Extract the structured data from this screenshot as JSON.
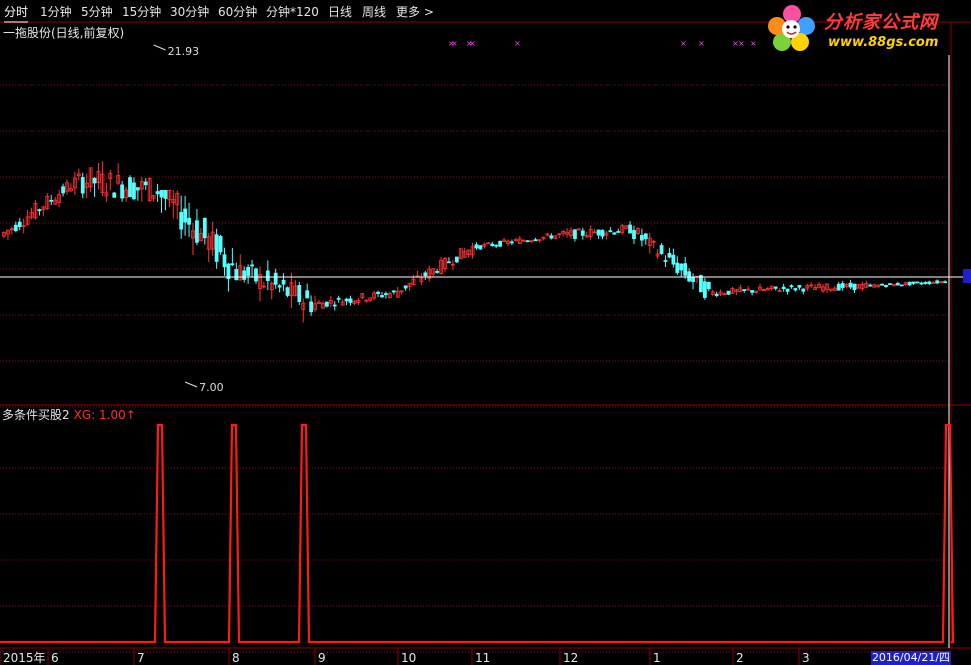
{
  "toolbar": {
    "tabs": [
      "分时",
      "1分钟",
      "5分钟",
      "15分钟",
      "30分钟",
      "60分钟",
      "分钟*120",
      "日线",
      "周线",
      "更多 >"
    ],
    "active": "分时"
  },
  "logo": {
    "brand": "分析家公式网",
    "url": "www.88gs.com",
    "icon": "flower-logo-icon"
  },
  "stock": {
    "title": "一拖股份(日线,前复权)"
  },
  "indicator": {
    "name": "多条件买股2",
    "xg_label": "XG: 1.00",
    "arrow": "↑"
  },
  "colors": {
    "up": "#ff3232",
    "down": "#54ffff",
    "signal": "#ff1a1a",
    "grid": "#8b0000",
    "marker": "#ff40ff",
    "crosshair": "#ffffff"
  },
  "status": {
    "date": "2016/04/21/四"
  },
  "chart_data": [
    {
      "type": "candlestick",
      "title": "一拖股份(日线,前复权)",
      "ylim": [
        7.0,
        21.93
      ],
      "annotations": [
        {
          "label": "21.93",
          "kind": "high"
        },
        {
          "label": "7.00",
          "kind": "low"
        }
      ],
      "x_tick_labels": [
        "2015年",
        "6",
        "7",
        "8",
        "9",
        "10",
        "11",
        "12",
        "1",
        "2",
        "3"
      ],
      "crosshair_value": 11.7,
      "ohlc_summary": [
        {
          "month": "2015-05",
          "open": 13.5,
          "high": 16.5,
          "low": 13.0,
          "close": 16.0
        },
        {
          "month": "2015-06",
          "open": 16.0,
          "high": 21.93,
          "low": 15.0,
          "close": 15.5
        },
        {
          "month": "2015-07",
          "open": 15.5,
          "high": 15.5,
          "low": 7.0,
          "close": 12.0
        },
        {
          "month": "2015-08",
          "open": 12.0,
          "high": 15.5,
          "low": 9.0,
          "close": 10.5
        },
        {
          "month": "2015-09",
          "open": 10.5,
          "high": 11.5,
          "low": 9.3,
          "close": 11.0
        },
        {
          "month": "2015-10",
          "open": 11.0,
          "high": 13.5,
          "low": 10.8,
          "close": 13.0
        },
        {
          "month": "2015-11",
          "open": 13.0,
          "high": 14.2,
          "low": 12.8,
          "close": 13.5
        },
        {
          "month": "2015-12",
          "open": 13.5,
          "high": 14.8,
          "low": 12.5,
          "close": 13.8
        },
        {
          "month": "2016-01",
          "open": 13.8,
          "high": 14.5,
          "low": 10.5,
          "close": 11.0
        },
        {
          "month": "2016-02",
          "open": 11.0,
          "high": 12.0,
          "low": 10.3,
          "close": 11.2
        },
        {
          "month": "2016-03",
          "open": 11.2,
          "high": 11.9,
          "low": 10.2,
          "close": 11.3
        },
        {
          "month": "2016-04",
          "open": 11.3,
          "high": 11.8,
          "low": 11.0,
          "close": 11.5
        }
      ]
    },
    {
      "type": "line",
      "title": "多条件买股2",
      "series": [
        {
          "name": "XG",
          "values": [
            0,
            0,
            1,
            0,
            0,
            1,
            0,
            1,
            0,
            0,
            0,
            0,
            0,
            0,
            0,
            0,
            0,
            0,
            1
          ]
        }
      ],
      "ylim": [
        0,
        1
      ],
      "latest_value": 1.0
    }
  ]
}
